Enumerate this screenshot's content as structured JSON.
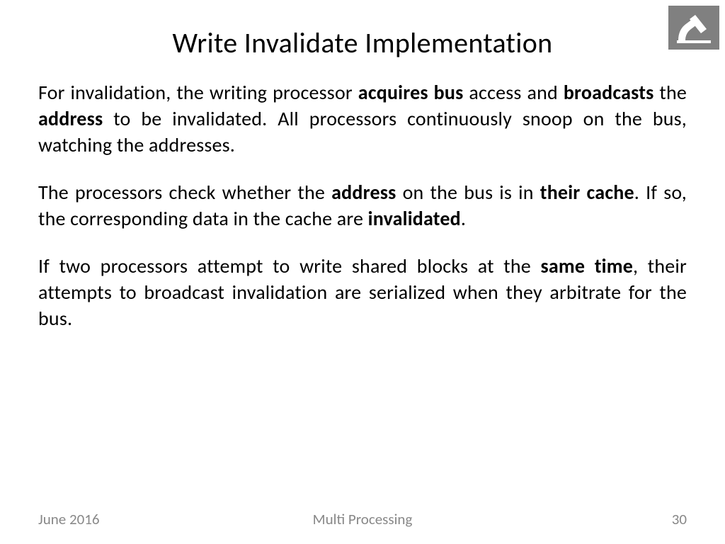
{
  "title": "Write Invalidate Implementation",
  "paragraphs": {
    "p1": {
      "s1": "For invalidation, the writing processor ",
      "b1": "acquires bus",
      "s2": " access and ",
      "b2": "broadcasts",
      "s3": " the ",
      "b3": "address",
      "s4": " to be invalidated. All processors continuously snoop on the bus, watching the addresses."
    },
    "p2": {
      "s1": "The processors check whether the ",
      "b1": "address",
      "s2": " on the bus is in ",
      "b2": "their cache",
      "s3": ". If so, the corresponding data in the cache are ",
      "b3": "invalidated",
      "s4": "."
    },
    "p3": {
      "s1": "If two processors attempt to write shared blocks at the ",
      "b1": "same time",
      "s2": ", their attempts to broadcast invalidation are serialized when they arbitrate for the bus."
    }
  },
  "footer": {
    "date": "June 2016",
    "topic": "Multi Processing",
    "page": "30"
  }
}
